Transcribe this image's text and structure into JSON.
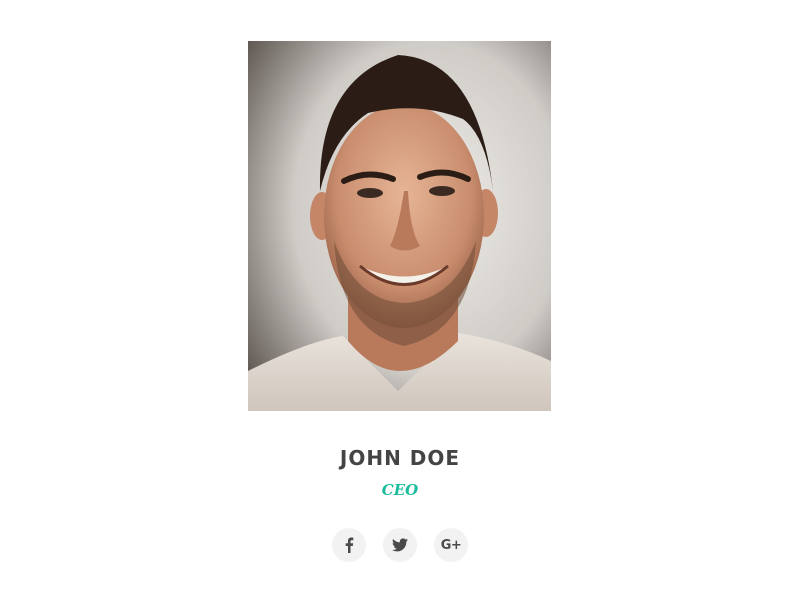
{
  "profile": {
    "name": "JOHN DOE",
    "role": "CEO"
  },
  "social": {
    "items": [
      {
        "icon": "facebook-icon"
      },
      {
        "icon": "twitter-icon"
      },
      {
        "icon": "google-plus-icon",
        "glyph": "G+"
      }
    ]
  },
  "colors": {
    "name": "#444444",
    "role_accent": "#1abc9c",
    "social_bg": "#f2f2f2",
    "social_icon": "#4a4a4a"
  }
}
